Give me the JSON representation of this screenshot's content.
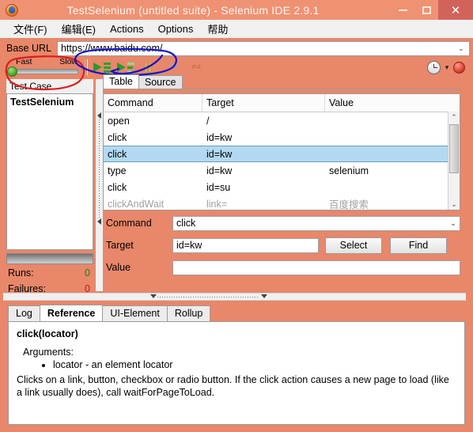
{
  "window": {
    "title": "TestSelenium (untitled suite) - Selenium IDE 2.9.1",
    "app_icon": "firefox-icon",
    "minimize_label": "–",
    "maximize_label": "□",
    "close_label": "✕",
    "titlebar_color": "#ef9273",
    "close_button_color": "#d3625a"
  },
  "menu": {
    "items": [
      {
        "label": "文件(F)",
        "name": "menu-file"
      },
      {
        "label": "编辑(E)",
        "name": "menu-edit"
      },
      {
        "label": "Actions",
        "name": "menu-actions"
      },
      {
        "label": "Options",
        "name": "menu-options"
      },
      {
        "label": "帮助",
        "name": "menu-help"
      }
    ]
  },
  "baseurl": {
    "label": "Base URL",
    "value": "https://www.baidu.com/",
    "placeholder": "",
    "dropdown_arrow": "⌄"
  },
  "toolbar": {
    "speed_fast_label": "Fast",
    "speed_slow_label": "Slow",
    "speed_position": "fast",
    "buttons": [
      {
        "name": "run-all-tests-button",
        "icon": "play-all-icon",
        "title": "Play entire test suite"
      },
      {
        "name": "run-current-test-button",
        "icon": "play-current-icon",
        "title": "Play current test case"
      },
      {
        "name": "pause-resume-button",
        "icon": "pause-icon",
        "title": "Pause/Resume"
      },
      {
        "name": "step-button",
        "icon": "step-icon",
        "title": "Step"
      },
      {
        "name": "rollup-button",
        "icon": "spiral-icon",
        "title": "Apply rollup rules"
      }
    ],
    "clock_icon": "clock-icon",
    "clock_dropdown_arrow": "▾",
    "record_button": "record-icon"
  },
  "left_panel": {
    "header": "Test Case",
    "test_cases": [
      {
        "label": "TestSelenium",
        "selected": true
      }
    ],
    "runs_label": "Runs:",
    "runs_value": "0",
    "runs_color": "#118811",
    "failures_label": "Failures:",
    "failures_value": "0",
    "failures_color": "#cc1111"
  },
  "editor": {
    "tabs": [
      {
        "label": "Table",
        "active": true
      },
      {
        "label": "Source",
        "active": false
      }
    ],
    "columns": [
      "Command",
      "Target",
      "Value"
    ],
    "rows": [
      {
        "command": "open",
        "target": "/",
        "value": "",
        "selected": false,
        "partial": false
      },
      {
        "command": "click",
        "target": "id=kw",
        "value": "",
        "selected": false,
        "partial": false
      },
      {
        "command": "click",
        "target": "id=kw",
        "value": "",
        "selected": true,
        "partial": false
      },
      {
        "command": "type",
        "target": "id=kw",
        "value": "selenium",
        "selected": false,
        "partial": false
      },
      {
        "command": "click",
        "target": "id=su",
        "value": "",
        "selected": false,
        "partial": false
      },
      {
        "command": "clickAndWait",
        "target": "link=",
        "value": "百度搜索",
        "selected": false,
        "partial": true
      }
    ],
    "scroll_up_arrow": "⌃",
    "scroll_down_arrow": "⌄",
    "form": {
      "command_label": "Command",
      "command_value": "click",
      "command_arrow": "⌄",
      "target_label": "Target",
      "target_value": "id=kw",
      "target_placeholder": "",
      "value_label": "Value",
      "value_value": "",
      "value_placeholder": "",
      "select_button": "Select",
      "find_button": "Find"
    }
  },
  "bottom_panel": {
    "tabs": [
      {
        "label": "Log",
        "active": false
      },
      {
        "label": "Reference",
        "active": true
      },
      {
        "label": "UI-Element",
        "active": false
      },
      {
        "label": "Rollup",
        "active": false
      }
    ],
    "reference": {
      "title": "click(locator)",
      "arguments_label": "Arguments:",
      "arguments": [
        "locator - an element locator"
      ],
      "description": "Clicks on a link, button, checkbox or radio button. If the click action causes a new page to load (like a link usually does), call waitForPageToLoad."
    }
  },
  "annotations": [
    {
      "name": "red-ellipse-speed-control",
      "shape": "ellipse",
      "color": "#e01b1b"
    },
    {
      "name": "blue-ellipse-run-buttons",
      "shape": "ellipse",
      "color": "#1414c8"
    },
    {
      "name": "blue-arrow-run-current-test",
      "shape": "arrow",
      "color": "#1414c8"
    }
  ]
}
